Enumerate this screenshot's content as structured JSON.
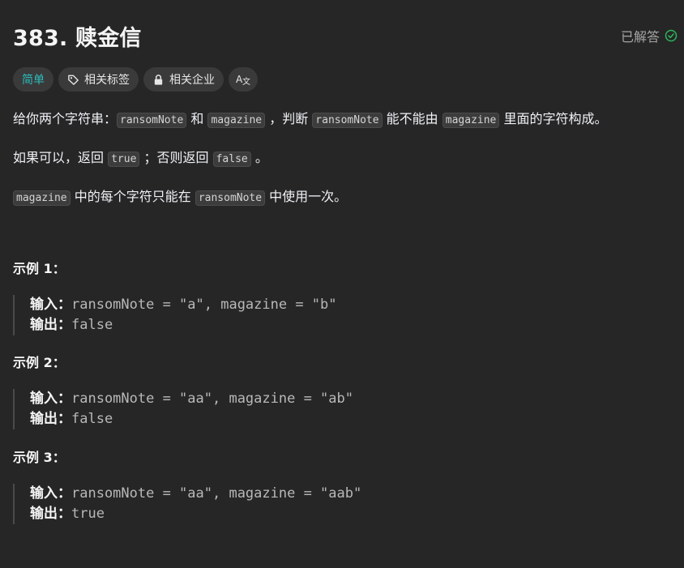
{
  "problem": {
    "title": "383. 赎金信",
    "status": "已解答"
  },
  "tags": {
    "difficulty": "简单",
    "topics": "相关标签",
    "companies": "相关企业",
    "translate_icon": "translate-icon"
  },
  "description": {
    "p1_prefix": "给你两个字符串：",
    "p1_code1": "ransomNote",
    "p1_and": " 和 ",
    "p1_code2": "magazine",
    "p1_mid": " ，判断 ",
    "p1_code3": "ransomNote",
    "p1_mid2": " 能不能由 ",
    "p1_code4": "magazine",
    "p1_suffix": " 里面的字符构成。",
    "p2_prefix": "如果可以，返回 ",
    "p2_code1": "true",
    "p2_mid": " ；否则返回 ",
    "p2_code2": "false",
    "p2_suffix": " 。",
    "p3_code1": "magazine",
    "p3_mid": " 中的每个字符只能在 ",
    "p3_code2": "ransomNote",
    "p3_suffix": " 中使用一次。"
  },
  "examples": [
    {
      "title": "示例 1：",
      "input_label": "输入：",
      "input_value": "ransomNote = \"a\", magazine = \"b\"",
      "output_label": "输出：",
      "output_value": "false"
    },
    {
      "title": "示例 2：",
      "input_label": "输入：",
      "input_value": "ransomNote = \"aa\", magazine = \"ab\"",
      "output_label": "输出：",
      "output_value": "false"
    },
    {
      "title": "示例 3：",
      "input_label": "输入：",
      "input_value": "ransomNote = \"aa\", magazine = \"aab\"",
      "output_label": "输出：",
      "output_value": "true"
    }
  ],
  "colors": {
    "background": "#262626",
    "easy": "#2cbbbb",
    "solved_check": "#2db55d"
  }
}
